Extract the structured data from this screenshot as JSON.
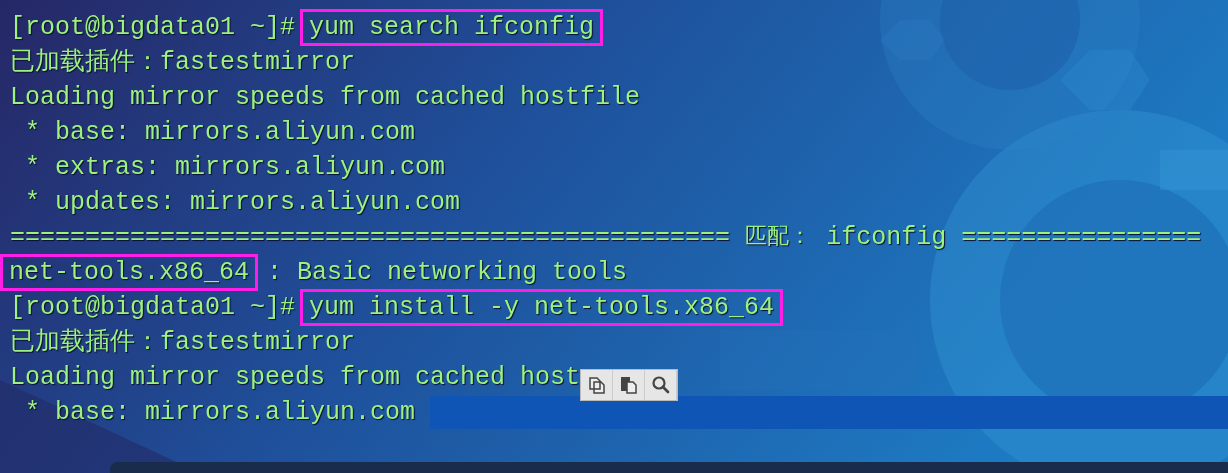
{
  "terminal": {
    "lines": [
      {
        "kind": "prompt",
        "prompt": "[root@bigdata01 ~]#",
        "command": "yum search ifconfig",
        "boxed": true,
        "highlighted": false
      },
      {
        "kind": "text",
        "text": "已加载插件：fastestmirror",
        "highlighted": false
      },
      {
        "kind": "text",
        "text": "Loading mirror speeds from cached hostfile",
        "highlighted": false
      },
      {
        "kind": "text",
        "text": " * base: mirrors.aliyun.com",
        "highlighted": false
      },
      {
        "kind": "text",
        "text": " * extras: mirrors.aliyun.com",
        "highlighted": false
      },
      {
        "kind": "text",
        "text": " * updates: mirrors.aliyun.com",
        "highlighted": false
      },
      {
        "kind": "separator",
        "left": "================================================",
        "label": "匹配：",
        "term": "ifconfig",
        "right": "================",
        "highlighted": false
      },
      {
        "kind": "result",
        "name": "net-tools.x86_64",
        "description": ": Basic networking tools",
        "boxed": true,
        "highlighted": false
      },
      {
        "kind": "prompt",
        "prompt": "[root@bigdata01 ~]#",
        "command": "yum install -y net-tools.x86_64",
        "boxed": true,
        "highlighted": false
      },
      {
        "kind": "text",
        "text": "已加载插件：fastestmirror",
        "highlighted": false
      },
      {
        "kind": "text",
        "text": "Loading mirror speeds from cached host",
        "highlighted": false
      },
      {
        "kind": "text",
        "text": " * base: mirrors.aliyun.com",
        "highlighted": true
      }
    ]
  },
  "toolbar": {
    "buttons": [
      {
        "kind": "copy"
      },
      {
        "kind": "paste"
      },
      {
        "kind": "search"
      }
    ]
  }
}
